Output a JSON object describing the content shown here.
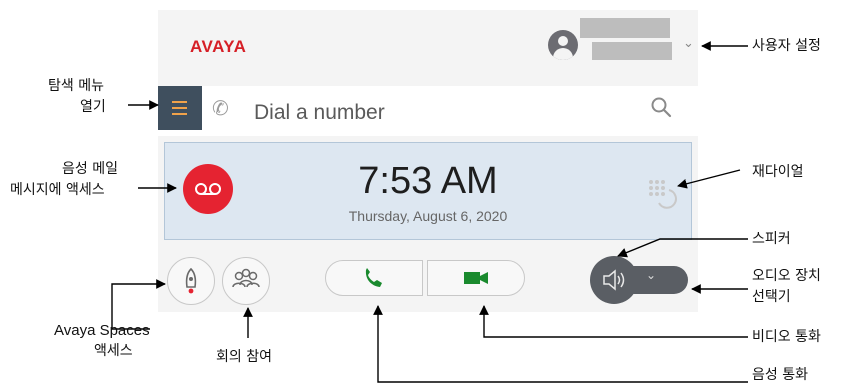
{
  "app": {
    "brand": "AVAYA",
    "search_placeholder": "Dial a number",
    "time": "7:53 AM",
    "date": "Thursday, August 6, 2020"
  },
  "icons": [
    "user-avatar-icon",
    "chevron-down-icon",
    "menu-icon",
    "phone-icon",
    "search-icon",
    "voicemail-icon",
    "redial-icon",
    "avaya-spaces-icon",
    "conference-icon",
    "audio-call-icon",
    "video-call-icon",
    "speaker-icon"
  ],
  "colors": {
    "brand": "#d61f26",
    "voicemail": "#e52331",
    "call_green": "#1a8a2e",
    "menu_bg": "#3f4f5e",
    "card_bg": "#dde7f1"
  },
  "callouts": {
    "user_settings": "사용자 설정",
    "nav_menu_l1": "탐색 메뉴",
    "nav_menu_l2": "열기",
    "voicemail_l1": "음성 메일",
    "voicemail_l2": "메시지에 액세스",
    "redial": "재다이얼",
    "speaker": "스피커",
    "audio_device_l1": "오디오 장치",
    "audio_device_l2": "선택기",
    "spaces_l1": "Avaya Spaces",
    "spaces_l2": "액세스",
    "meeting": "회의 참여",
    "video_call": "비디오 통화",
    "audio_call": "음성 통화"
  }
}
